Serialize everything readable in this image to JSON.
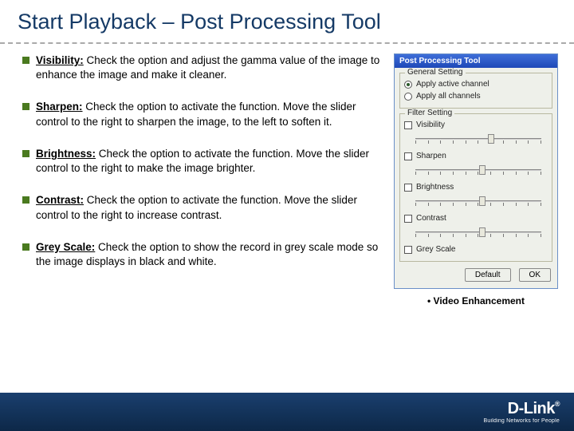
{
  "title": "Start Playback – Post Processing Tool",
  "bullets": [
    {
      "name": "Visibility:",
      "text": " Check the option and adjust the gamma value of the image to enhance the image and make it cleaner."
    },
    {
      "name": "Sharpen:",
      "text": " Check the option to activate the function. Move the slider control to the right to sharpen the image, to the left to soften it."
    },
    {
      "name": "Brightness:",
      "text": " Check the option to activate the function. Move the slider control to the right to make the image brighter."
    },
    {
      "name": "Contrast:",
      "text": " Check the option to activate the function. Move the slider control to the right to increase contrast."
    },
    {
      "name": "Grey Scale:",
      "text": " Check the option to show the record in grey scale mode so the image displays in black and white."
    }
  ],
  "win": {
    "title": "Post Processing Tool",
    "group1_label": "General Setting",
    "radio1": "Apply active channel",
    "radio2": "Apply all channels",
    "group2_label": "Filter Setting",
    "f1": "Visibility",
    "f2": "Sharpen",
    "f3": "Brightness",
    "f4": "Contrast",
    "f5": "Grey Scale",
    "btn_default": "Default",
    "btn_ok": "OK"
  },
  "caption": "Video Enhancement",
  "logo": {
    "brand": "D-Link",
    "tag": "Building Networks for People"
  }
}
